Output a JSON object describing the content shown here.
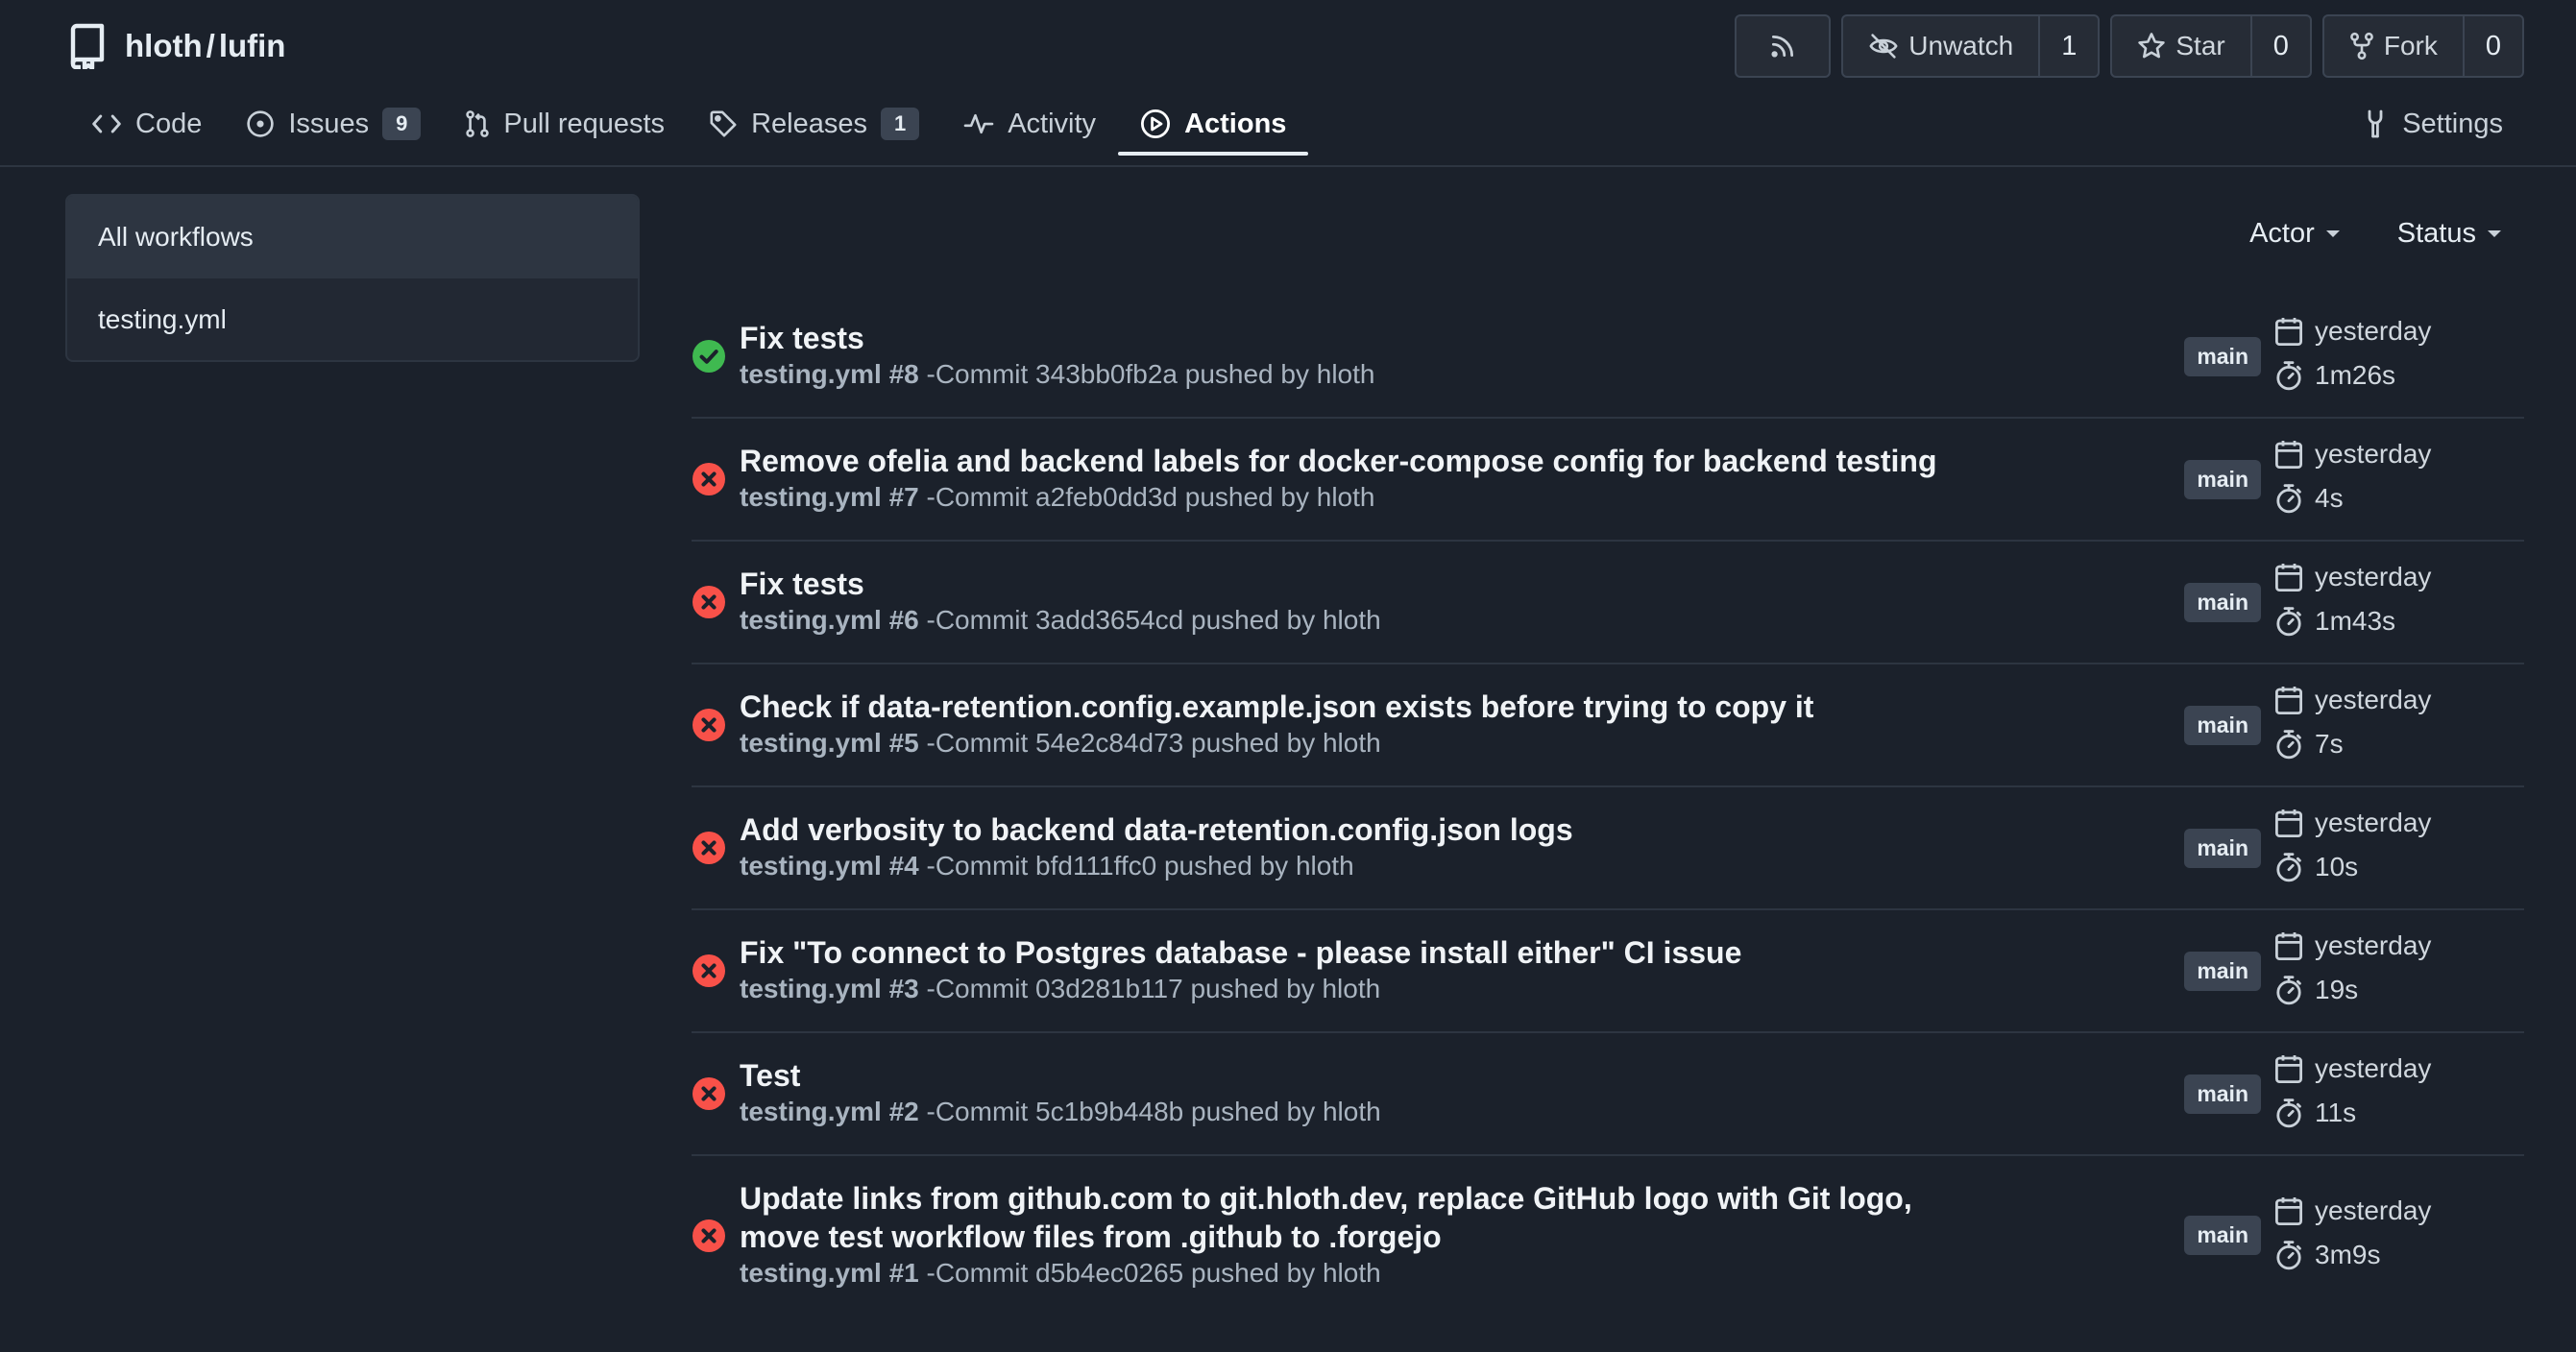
{
  "repo": {
    "owner": "hloth",
    "separator": "/",
    "name": "lufin"
  },
  "header_buttons": {
    "rss_icon": "rss-icon",
    "unwatch_label": "Unwatch",
    "unwatch_count": "1",
    "star_label": "Star",
    "star_count": "0",
    "fork_label": "Fork",
    "fork_count": "0"
  },
  "tabs": [
    {
      "label": "Code",
      "icon": "code-icon"
    },
    {
      "label": "Issues",
      "icon": "issue-icon",
      "badge": "9"
    },
    {
      "label": "Pull requests",
      "icon": "pull-request-icon"
    },
    {
      "label": "Releases",
      "icon": "tag-icon",
      "badge": "1"
    },
    {
      "label": "Activity",
      "icon": "pulse-icon"
    },
    {
      "label": "Actions",
      "icon": "play-icon",
      "active": true
    },
    {
      "label": "Settings",
      "icon": "tools-icon"
    }
  ],
  "sidebar": {
    "items": [
      {
        "label": "All workflows",
        "active": true
      },
      {
        "label": "testing.yml"
      }
    ]
  },
  "filters": {
    "actor": "Actor",
    "status": "Status"
  },
  "colors": {
    "success": "#3fb950",
    "failure": "#f85149",
    "background": "#1b212b"
  },
  "runs": [
    {
      "status": "success",
      "title": "Fix tests",
      "workflow": "testing.yml #8",
      "commit_text": "-Commit 343bb0fb2a pushed by hloth",
      "branch": "main",
      "when": "yesterday",
      "duration": "1m26s"
    },
    {
      "status": "failure",
      "title": "Remove ofelia and backend labels for docker-compose config for backend testing",
      "workflow": "testing.yml #7",
      "commit_text": "-Commit a2feb0dd3d pushed by hloth",
      "branch": "main",
      "when": "yesterday",
      "duration": "4s"
    },
    {
      "status": "failure",
      "title": "Fix tests",
      "workflow": "testing.yml #6",
      "commit_text": "-Commit 3add3654cd pushed by hloth",
      "branch": "main",
      "when": "yesterday",
      "duration": "1m43s"
    },
    {
      "status": "failure",
      "title": "Check if data-retention.config.example.json exists before trying to copy it",
      "workflow": "testing.yml #5",
      "commit_text": "-Commit 54e2c84d73 pushed by hloth",
      "branch": "main",
      "when": "yesterday",
      "duration": "7s"
    },
    {
      "status": "failure",
      "title": "Add verbosity to backend data-retention.config.json logs",
      "workflow": "testing.yml #4",
      "commit_text": "-Commit bfd111ffc0 pushed by hloth",
      "branch": "main",
      "when": "yesterday",
      "duration": "10s"
    },
    {
      "status": "failure",
      "title": "Fix \"To connect to Postgres database - please install either\" CI issue",
      "workflow": "testing.yml #3",
      "commit_text": "-Commit 03d281b117 pushed by hloth",
      "branch": "main",
      "when": "yesterday",
      "duration": "19s"
    },
    {
      "status": "failure",
      "title": "Test",
      "workflow": "testing.yml #2",
      "commit_text": "-Commit 5c1b9b448b pushed by hloth",
      "branch": "main",
      "when": "yesterday",
      "duration": "11s"
    },
    {
      "status": "failure",
      "title": "Update links from github.com to git.hloth.dev, replace GitHub logo with Git logo, move test workflow files from .github to .forgejo",
      "workflow": "testing.yml #1",
      "commit_text": "-Commit d5b4ec0265 pushed by hloth",
      "branch": "main",
      "when": "yesterday",
      "duration": "3m9s"
    }
  ]
}
